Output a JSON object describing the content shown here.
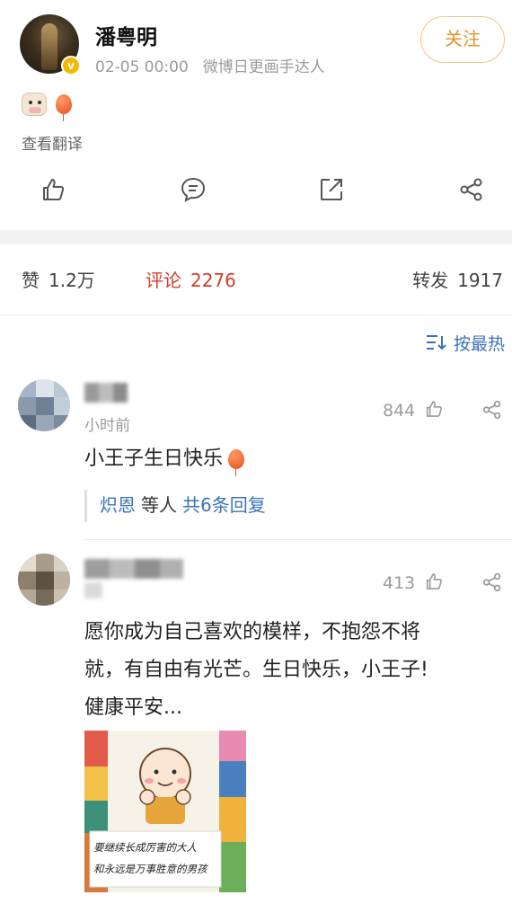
{
  "post": {
    "username": "潘粤明",
    "time": "02-05 00:00",
    "source": "微博日更画手达人",
    "follow_label": "关注",
    "translate_label": "查看翻译"
  },
  "actions": {
    "like_icon": "thumb-up-icon",
    "comment_icon": "comment-icon",
    "repost_icon": "repost-icon",
    "share_icon": "share-icon"
  },
  "stats": {
    "like_label": "赞",
    "like_count": "1.2万",
    "comment_label": "评论",
    "comment_count": "2276",
    "repost_label": "转发",
    "repost_count": "1917"
  },
  "sort": {
    "label": "按最热"
  },
  "comments": [
    {
      "time": "小时前",
      "likes": "844",
      "text": "小王子生日快乐",
      "reply": {
        "user": "炽恩",
        "etc": "等人",
        "count": "共6条回复"
      }
    },
    {
      "likes": "413",
      "text_lines": [
        "愿你成为自己喜欢的模样，不抱怨不将",
        "就，有自由有光芒。生日快乐，小王子!",
        "健康平安..."
      ],
      "image_caption": [
        "要继续长成厉害的大人",
        "和永远是万事胜意的男孩"
      ]
    }
  ],
  "colors": {
    "accent_blue": "#3b73b9",
    "comment_red": "#d83a2a",
    "follow_orange": "#e8912c",
    "verified_gold": "#f5b800"
  }
}
